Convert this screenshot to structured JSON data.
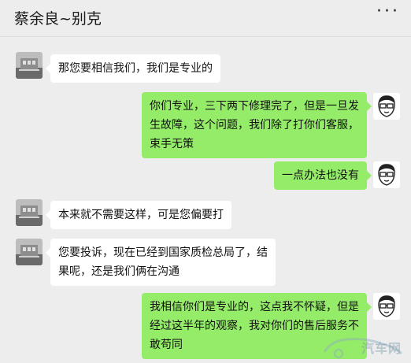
{
  "header": {
    "title": "蔡余良~别克",
    "more_icon": "more-dots-icon"
  },
  "messages": [
    {
      "side": "left",
      "avatar": "building-photo-avatar",
      "text": "那您要相信我们，我们是专业的"
    },
    {
      "side": "right",
      "avatar": "cartoon-face-glasses-avatar",
      "text": "你们专业，三下两下修理完了，但是一旦发生故障，这个问题，我们除了打你们客服，束手无策"
    },
    {
      "side": "right",
      "avatar": "cartoon-face-glasses-avatar",
      "text": "一点办法也没有"
    },
    {
      "side": "left",
      "avatar": "building-photo-avatar",
      "text": "本来就不需要这样，可是您偏要打"
    },
    {
      "side": "left",
      "avatar": "building-photo-avatar",
      "text": "您要投诉，现在已经到国家质检总局了，结果呢，还是我们俩在沟通"
    },
    {
      "side": "right",
      "avatar": "cartoon-face-glasses-avatar",
      "text": "我相信你们是专业的，这点我不怀疑，但是经过这半年的观察，我对你们的售后服务不敢苟同"
    }
  ],
  "watermark": {
    "text": "汽车网",
    "icon": "car-logo-icon"
  },
  "colors": {
    "background": "#ededed",
    "sent_bubble": "#95ec69",
    "received_bubble": "#ffffff"
  }
}
